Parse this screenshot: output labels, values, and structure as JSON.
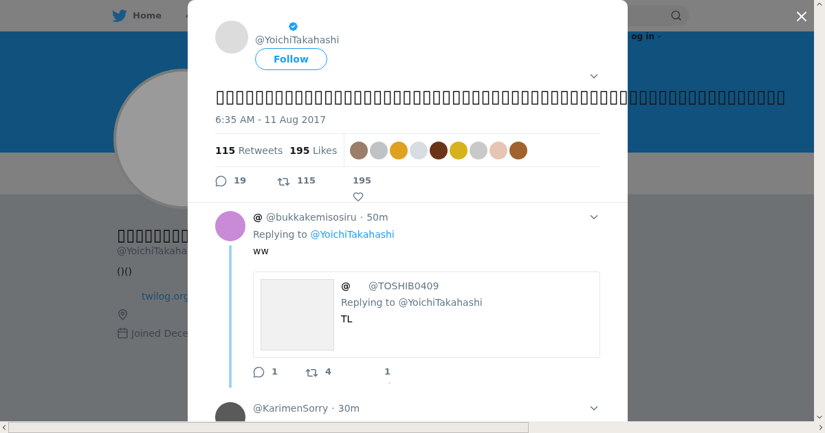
{
  "background": {
    "nav": {
      "home_label": "Home",
      "login_label": "og in"
    },
    "profile": {
      "name": "▯▯▯▯▯▯▯▯",
      "handle": "@YoichiTakaha",
      "bio": "()()",
      "link": "twilog.org",
      "joined": "Joined Dece"
    }
  },
  "tweet": {
    "author_handle": "@YoichiTakahashi",
    "verified": true,
    "follow_label": "Follow",
    "text": "▯▯▯▯▯▯▯▯▯▯▯▯▯▯▯▯▯▯▯▯▯▯▯▯▯▯▯▯▯▯▯▯▯▯▯▯▯▯▯▯▯▯▯▯▯▯▯▯▯▯▯▯▯▯▯▯▯▯",
    "timestamp": "6:35 AM - 11 Aug 2017",
    "retweets_count": "115",
    "retweets_label": "Retweets",
    "likes_count": "195",
    "likes_label": "Likes",
    "likers": [
      {
        "color": "#9a7e6a"
      },
      {
        "color": "#bfc3c6"
      },
      {
        "color": "#e0a020"
      },
      {
        "color": "#d8dde2"
      },
      {
        "color": "#6a3418"
      },
      {
        "color": "#d8b21c"
      },
      {
        "color": "#c9c9c9"
      },
      {
        "color": "#e6c5b5"
      },
      {
        "color": "#a0622e"
      }
    ],
    "actions": {
      "replies": "19",
      "retweets": "115",
      "likes": "195"
    }
  },
  "replies": [
    {
      "name": "@",
      "handle": "@bukkakemisosiru",
      "separator": "·",
      "time": "50m",
      "color": "#c98ad8",
      "thread_line": true,
      "replying_to_label": "Replying to",
      "replying_to": "@YoichiTakahashi",
      "text": "ww",
      "quote": {
        "name": "@",
        "handle": "@TOSHIB0409",
        "replying_to": "Replying to @YoichiTakahashi",
        "text": "TL"
      },
      "actions": {
        "replies": "1",
        "retweets": "4",
        "likes": "1"
      }
    },
    {
      "handle": "@KarimenSorry",
      "separator": "·",
      "time": "30m",
      "color": "#5a5a5a",
      "thread_line": false
    }
  ]
}
